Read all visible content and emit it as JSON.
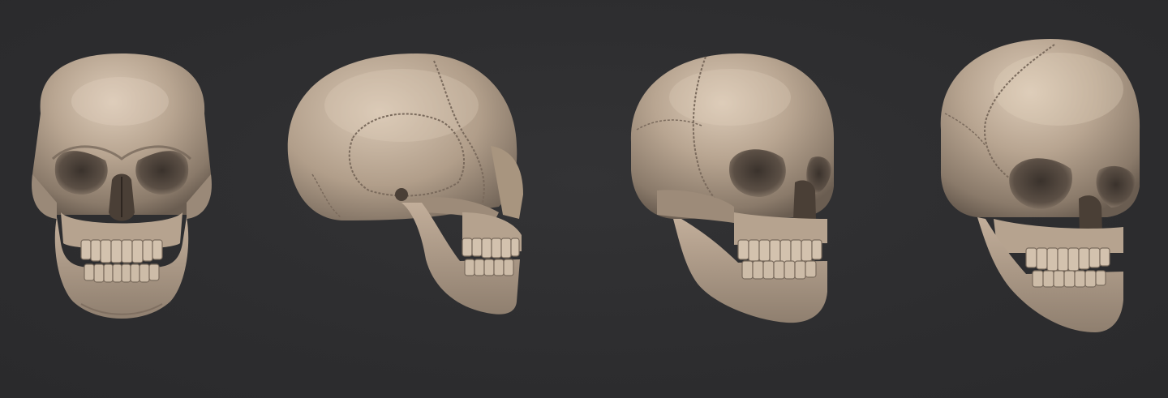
{
  "scene": {
    "background_color": "#2e2e30",
    "material_color": "#b39f8b",
    "material_highlight": "#d8c6b2",
    "material_shadow": "#6d5f52",
    "views": [
      {
        "name": "front"
      },
      {
        "name": "side-right"
      },
      {
        "name": "three-quarter-right"
      },
      {
        "name": "three-quarter-high"
      }
    ]
  }
}
